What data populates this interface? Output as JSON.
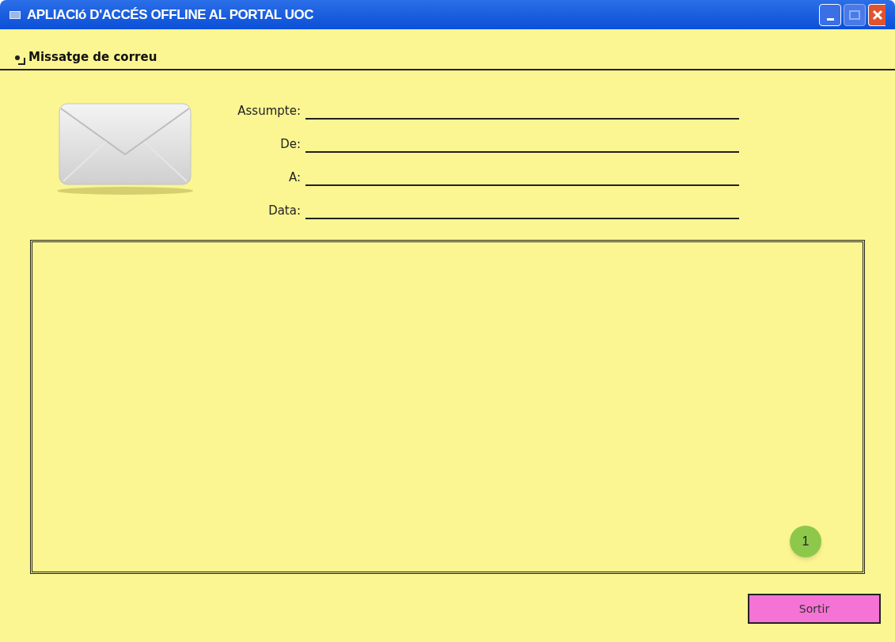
{
  "window": {
    "title": "APLIACIó D'ACCÉS OFFLINE AL PORTAL UOC"
  },
  "section": {
    "title": "Missatge de correu"
  },
  "fields": [
    {
      "label": "Assumpte:"
    },
    {
      "label": "De:"
    },
    {
      "label": "A:"
    },
    {
      "label": "Data:"
    }
  ],
  "message_area": {
    "badge": "1"
  },
  "buttons": [
    {
      "label": "Sortir"
    }
  ]
}
